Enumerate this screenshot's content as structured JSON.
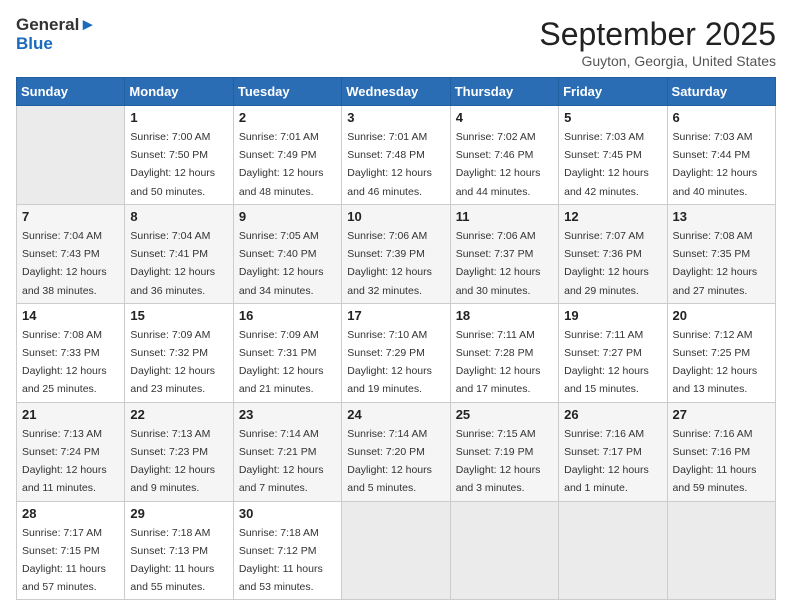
{
  "logo": {
    "line1": "General",
    "line2": "Blue"
  },
  "title": "September 2025",
  "subtitle": "Guyton, Georgia, United States",
  "headers": [
    "Sunday",
    "Monday",
    "Tuesday",
    "Wednesday",
    "Thursday",
    "Friday",
    "Saturday"
  ],
  "weeks": [
    [
      {
        "day": "",
        "empty": true
      },
      {
        "day": "1",
        "sunrise": "7:00 AM",
        "sunset": "7:50 PM",
        "daylight": "12 hours and 50 minutes."
      },
      {
        "day": "2",
        "sunrise": "7:01 AM",
        "sunset": "7:49 PM",
        "daylight": "12 hours and 48 minutes."
      },
      {
        "day": "3",
        "sunrise": "7:01 AM",
        "sunset": "7:48 PM",
        "daylight": "12 hours and 46 minutes."
      },
      {
        "day": "4",
        "sunrise": "7:02 AM",
        "sunset": "7:46 PM",
        "daylight": "12 hours and 44 minutes."
      },
      {
        "day": "5",
        "sunrise": "7:03 AM",
        "sunset": "7:45 PM",
        "daylight": "12 hours and 42 minutes."
      },
      {
        "day": "6",
        "sunrise": "7:03 AM",
        "sunset": "7:44 PM",
        "daylight": "12 hours and 40 minutes."
      }
    ],
    [
      {
        "day": "7",
        "sunrise": "7:04 AM",
        "sunset": "7:43 PM",
        "daylight": "12 hours and 38 minutes."
      },
      {
        "day": "8",
        "sunrise": "7:04 AM",
        "sunset": "7:41 PM",
        "daylight": "12 hours and 36 minutes."
      },
      {
        "day": "9",
        "sunrise": "7:05 AM",
        "sunset": "7:40 PM",
        "daylight": "12 hours and 34 minutes."
      },
      {
        "day": "10",
        "sunrise": "7:06 AM",
        "sunset": "7:39 PM",
        "daylight": "12 hours and 32 minutes."
      },
      {
        "day": "11",
        "sunrise": "7:06 AM",
        "sunset": "7:37 PM",
        "daylight": "12 hours and 30 minutes."
      },
      {
        "day": "12",
        "sunrise": "7:07 AM",
        "sunset": "7:36 PM",
        "daylight": "12 hours and 29 minutes."
      },
      {
        "day": "13",
        "sunrise": "7:08 AM",
        "sunset": "7:35 PM",
        "daylight": "12 hours and 27 minutes."
      }
    ],
    [
      {
        "day": "14",
        "sunrise": "7:08 AM",
        "sunset": "7:33 PM",
        "daylight": "12 hours and 25 minutes."
      },
      {
        "day": "15",
        "sunrise": "7:09 AM",
        "sunset": "7:32 PM",
        "daylight": "12 hours and 23 minutes."
      },
      {
        "day": "16",
        "sunrise": "7:09 AM",
        "sunset": "7:31 PM",
        "daylight": "12 hours and 21 minutes."
      },
      {
        "day": "17",
        "sunrise": "7:10 AM",
        "sunset": "7:29 PM",
        "daylight": "12 hours and 19 minutes."
      },
      {
        "day": "18",
        "sunrise": "7:11 AM",
        "sunset": "7:28 PM",
        "daylight": "12 hours and 17 minutes."
      },
      {
        "day": "19",
        "sunrise": "7:11 AM",
        "sunset": "7:27 PM",
        "daylight": "12 hours and 15 minutes."
      },
      {
        "day": "20",
        "sunrise": "7:12 AM",
        "sunset": "7:25 PM",
        "daylight": "12 hours and 13 minutes."
      }
    ],
    [
      {
        "day": "21",
        "sunrise": "7:13 AM",
        "sunset": "7:24 PM",
        "daylight": "12 hours and 11 minutes."
      },
      {
        "day": "22",
        "sunrise": "7:13 AM",
        "sunset": "7:23 PM",
        "daylight": "12 hours and 9 minutes."
      },
      {
        "day": "23",
        "sunrise": "7:14 AM",
        "sunset": "7:21 PM",
        "daylight": "12 hours and 7 minutes."
      },
      {
        "day": "24",
        "sunrise": "7:14 AM",
        "sunset": "7:20 PM",
        "daylight": "12 hours and 5 minutes."
      },
      {
        "day": "25",
        "sunrise": "7:15 AM",
        "sunset": "7:19 PM",
        "daylight": "12 hours and 3 minutes."
      },
      {
        "day": "26",
        "sunrise": "7:16 AM",
        "sunset": "7:17 PM",
        "daylight": "12 hours and 1 minute."
      },
      {
        "day": "27",
        "sunrise": "7:16 AM",
        "sunset": "7:16 PM",
        "daylight": "11 hours and 59 minutes."
      }
    ],
    [
      {
        "day": "28",
        "sunrise": "7:17 AM",
        "sunset": "7:15 PM",
        "daylight": "11 hours and 57 minutes."
      },
      {
        "day": "29",
        "sunrise": "7:18 AM",
        "sunset": "7:13 PM",
        "daylight": "11 hours and 55 minutes."
      },
      {
        "day": "30",
        "sunrise": "7:18 AM",
        "sunset": "7:12 PM",
        "daylight": "11 hours and 53 minutes."
      },
      {
        "day": "",
        "empty": true
      },
      {
        "day": "",
        "empty": true
      },
      {
        "day": "",
        "empty": true
      },
      {
        "day": "",
        "empty": true
      }
    ]
  ],
  "labels": {
    "sunrise": "Sunrise:",
    "sunset": "Sunset:",
    "daylight": "Daylight:"
  }
}
